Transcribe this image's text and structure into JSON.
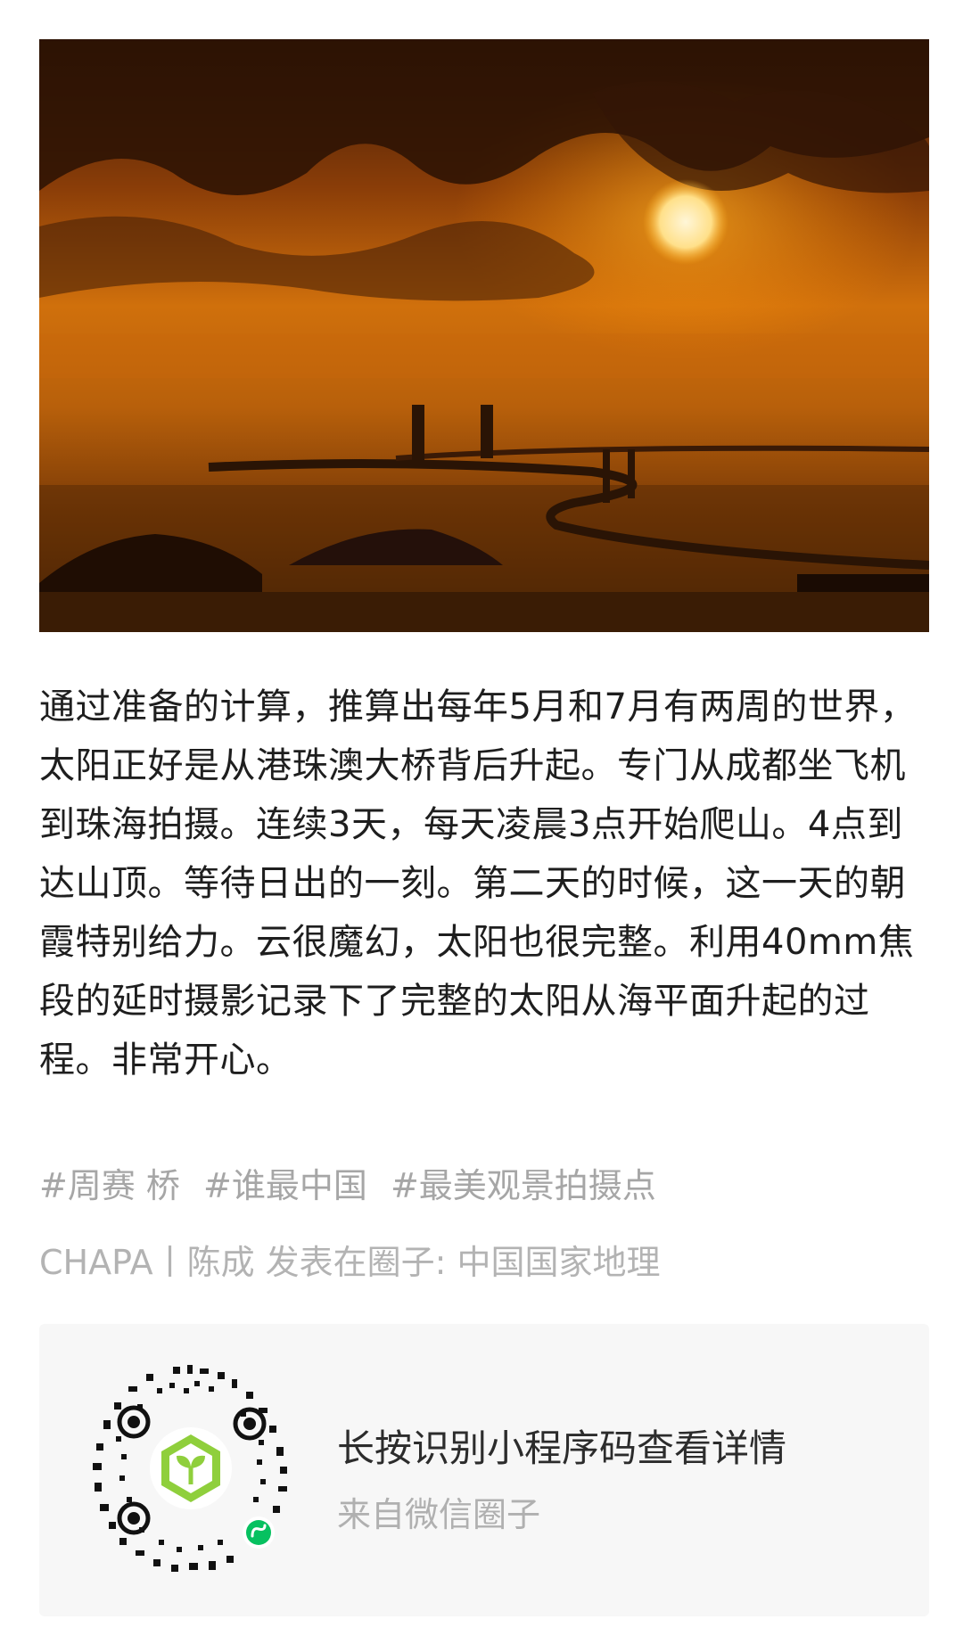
{
  "post": {
    "text": "通过准备的计算，推算出每年5月和7月有两周的世界，太阳正好是从港珠澳大桥背后升起。专门从成都坐飞机到珠海拍摄。连续3天，每天凌晨3点开始爬山。4点到达山顶。等待日出的一刻。第二天的时候，这一天的朝霞特别给力。云很魔幻，太阳也很完整。利用40mm焦段的延时摄影记录下了完整的太阳从海平面升起的过程。非常开心。",
    "tags": [
      "#周赛 桥",
      "#谁最中国",
      "#最美观景拍摄点"
    ],
    "source": "CHAPA丨陈成 发表在圈子: 中国国家地理"
  },
  "card": {
    "title": "长按识别小程序码查看详情",
    "subtitle": "来自微信圈子"
  },
  "colors": {
    "text": "#1e1e1e",
    "muted": "#a6a6a6",
    "card_bg": "#f7f7f7",
    "brand_green": "#8fcf3c",
    "mini_program_green": "#07c160"
  }
}
